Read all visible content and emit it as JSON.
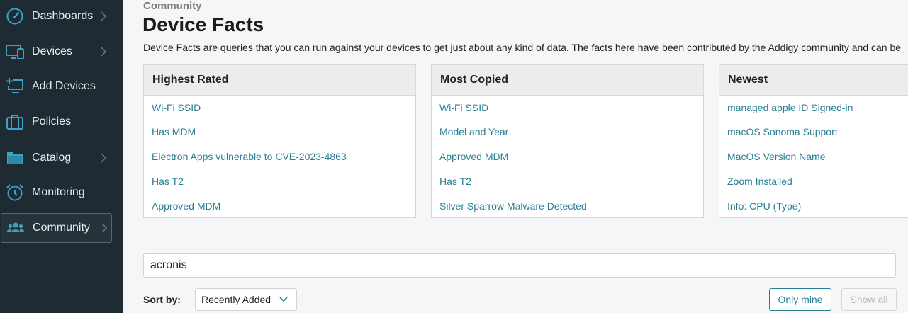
{
  "sidebar": {
    "items": [
      {
        "label": "Dashboards",
        "icon": "gauge-icon"
      },
      {
        "label": "Devices",
        "icon": "devices-icon"
      },
      {
        "label": "Add Devices",
        "icon": "add-device-icon"
      },
      {
        "label": "Policies",
        "icon": "briefcase-icon"
      },
      {
        "label": "Catalog",
        "icon": "catalog-icon"
      },
      {
        "label": "Monitoring",
        "icon": "alarm-clock-icon"
      },
      {
        "label": "Community",
        "icon": "users-icon",
        "active": true
      }
    ]
  },
  "header": {
    "breadcrumb": "Community",
    "title": "Device Facts",
    "description": "Device Facts are queries that you can run against your devices to get just about any kind of data. The facts here have been contributed by the Addigy community and can be"
  },
  "panels": [
    {
      "title": "Highest Rated",
      "items": [
        "Wi-Fi SSID",
        "Has MDM",
        "Electron Apps vulnerable to CVE-2023-4863",
        "Has T2",
        "Approved MDM"
      ]
    },
    {
      "title": "Most Copied",
      "items": [
        "Wi-Fi SSID",
        "Model and Year",
        "Approved MDM",
        "Has T2",
        "Silver Sparrow Malware Detected"
      ]
    },
    {
      "title": "Newest",
      "items": [
        "managed apple ID Signed-in",
        "macOS Sonoma Support",
        "MacOS Version Name",
        "Zoom Installed",
        "Info: CPU (Type)"
      ]
    }
  ],
  "search": {
    "value": "acronis"
  },
  "sort": {
    "label": "Sort by:",
    "value": "Recently Added"
  },
  "filters": {
    "only_mine": "Only mine",
    "show_all": "Show all"
  },
  "colors": {
    "sidebar_bg": "#1f2b33",
    "accent": "#2a7f96",
    "icon": "#3aa3c4"
  }
}
